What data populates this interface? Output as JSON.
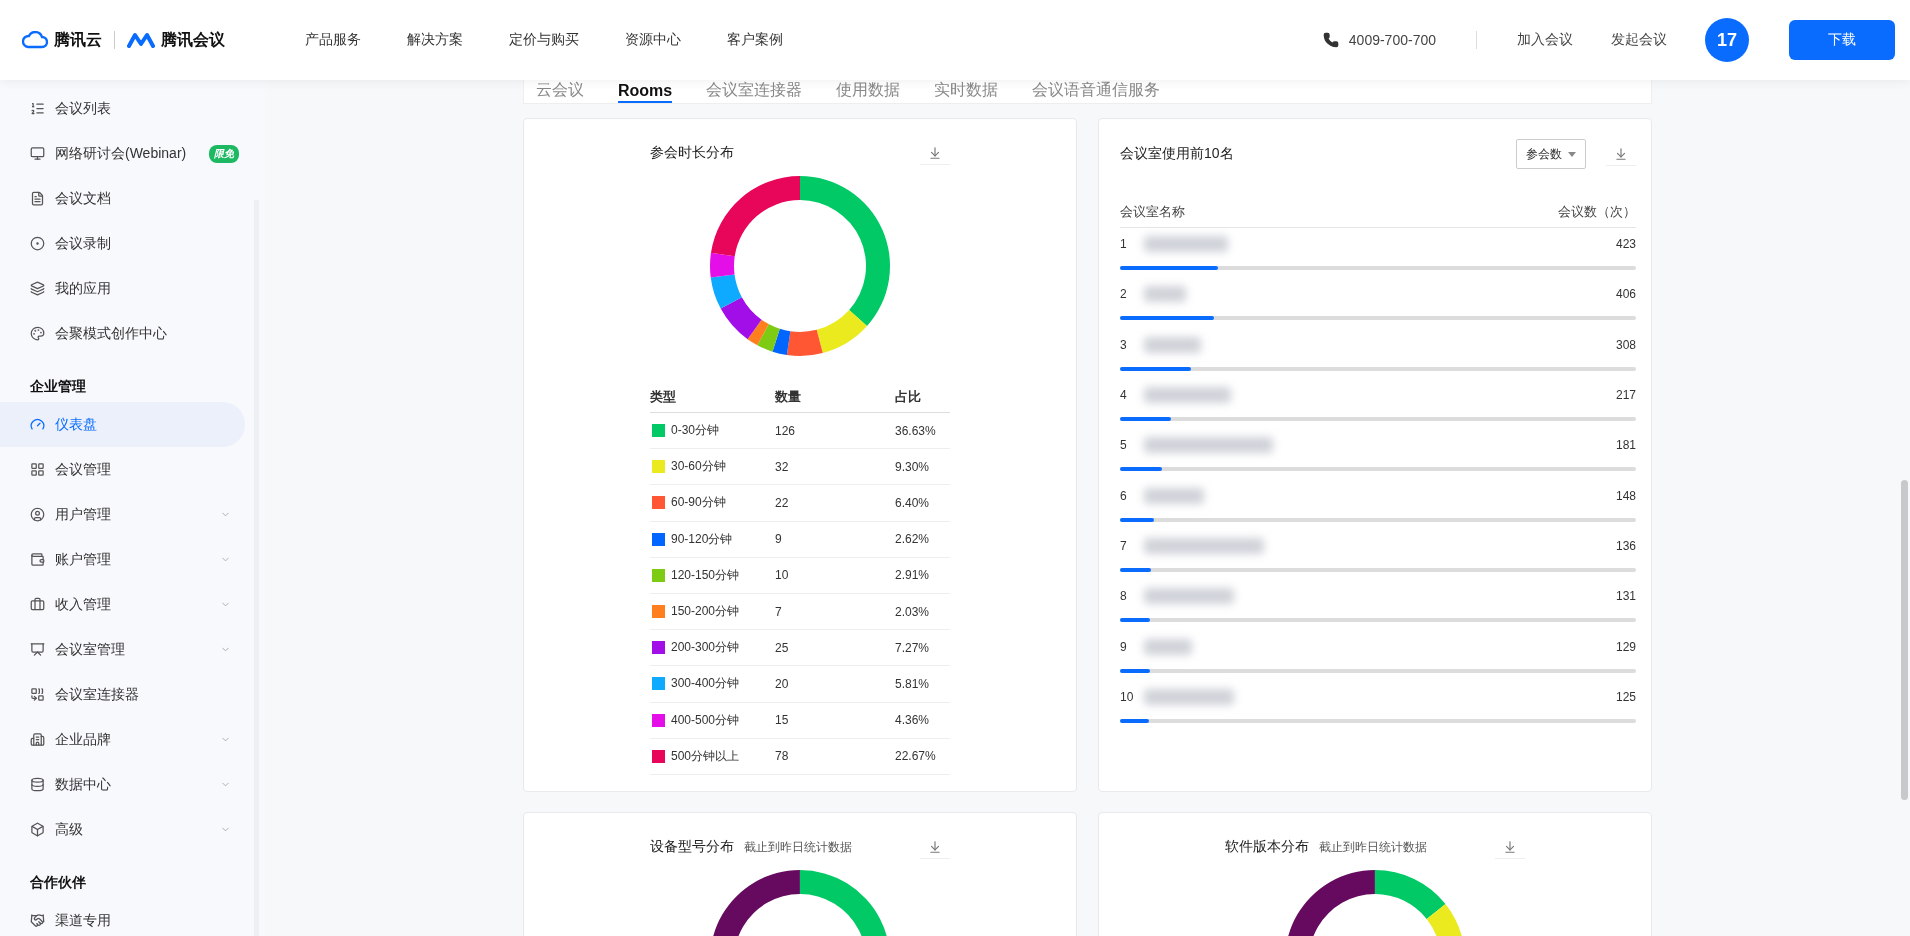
{
  "header": {
    "logo_cloud": "腾讯云",
    "logo_meeting": "腾讯会议",
    "nav": [
      "产品服务",
      "解决方案",
      "定价与购买",
      "资源中心",
      "客户案例"
    ],
    "phone": "4009-700-700",
    "links": [
      "加入会议",
      "发起会议"
    ],
    "avatar": "17",
    "download": "下载"
  },
  "sidebar": {
    "items": [
      {
        "kind": "item",
        "label": "会议列表",
        "selected": false,
        "collapsible": false
      },
      {
        "kind": "item",
        "label": "网络研讨会(Webinar)",
        "selected": false,
        "collapsible": false,
        "badge": "限免"
      },
      {
        "kind": "item",
        "label": "会议文档",
        "selected": false,
        "collapsible": false
      },
      {
        "kind": "item",
        "label": "会议录制",
        "selected": false,
        "collapsible": false
      },
      {
        "kind": "item",
        "label": "我的应用",
        "selected": false,
        "collapsible": false
      },
      {
        "kind": "item",
        "label": "会聚模式创作中心",
        "selected": false,
        "collapsible": false
      },
      {
        "kind": "section",
        "label": "企业管理"
      },
      {
        "kind": "item",
        "label": "仪表盘",
        "selected": true,
        "collapsible": false
      },
      {
        "kind": "item",
        "label": "会议管理",
        "selected": false,
        "collapsible": false
      },
      {
        "kind": "item",
        "label": "用户管理",
        "selected": false,
        "collapsible": true
      },
      {
        "kind": "item",
        "label": "账户管理",
        "selected": false,
        "collapsible": true
      },
      {
        "kind": "item",
        "label": "收入管理",
        "selected": false,
        "collapsible": true
      },
      {
        "kind": "item",
        "label": "会议室管理",
        "selected": false,
        "collapsible": true
      },
      {
        "kind": "item",
        "label": "会议室连接器",
        "selected": false,
        "collapsible": false
      },
      {
        "kind": "item",
        "label": "企业品牌",
        "selected": false,
        "collapsible": true
      },
      {
        "kind": "item",
        "label": "数据中心",
        "selected": false,
        "collapsible": true
      },
      {
        "kind": "item",
        "label": "高级",
        "selected": false,
        "collapsible": true
      },
      {
        "kind": "section",
        "label": "合作伙伴"
      },
      {
        "kind": "item",
        "label": "渠道专用",
        "selected": false,
        "collapsible": false
      }
    ]
  },
  "tabs": [
    {
      "label": "云会议",
      "selected": false
    },
    {
      "label": "Rooms",
      "selected": true
    },
    {
      "label": "会议室连接器",
      "selected": false
    },
    {
      "label": "使用数据",
      "selected": false
    },
    {
      "label": "实时数据",
      "selected": false
    },
    {
      "label": "会议语音通信服务",
      "selected": false
    }
  ],
  "duration_card": {
    "chart_data": {
      "type": "donut",
      "title": "参会时长分布",
      "categories": [
        "0-30分钟",
        "30-60分钟",
        "60-90分钟",
        "90-120分钟",
        "120-150分钟",
        "150-200分钟",
        "200-300分钟",
        "300-400分钟",
        "400-500分钟",
        "500分钟以上"
      ],
      "series": [
        {
          "name": "占比",
          "values": [
            36.63,
            9.3,
            6.4,
            2.62,
            2.91,
            2.03,
            7.27,
            5.81,
            4.36,
            22.67
          ]
        }
      ]
    },
    "columns": [
      "类型",
      "数量"
    ],
    "rows": [
      {
        "count": "126",
        "share": "36.63%",
        "color": "#00c965"
      },
      {
        "count": "32",
        "share": "9.30%",
        "color": "#eaea1e"
      },
      {
        "count": "22",
        "share": "6.40%",
        "color": "#ff5733"
      },
      {
        "count": "9",
        "share": "2.62%",
        "color": "#0066ff"
      },
      {
        "count": "10",
        "share": "2.91%",
        "color": "#7ecb14"
      },
      {
        "count": "7",
        "share": "2.03%",
        "color": "#ff7f1e"
      },
      {
        "count": "25",
        "share": "7.27%",
        "color": "#a10ee8"
      },
      {
        "count": "20",
        "share": "5.81%",
        "color": "#0eaaff"
      },
      {
        "count": "15",
        "share": "4.36%",
        "color": "#e40ee8"
      },
      {
        "count": "78",
        "share": "22.67%",
        "color": "#e8065a"
      }
    ]
  },
  "room_card": {
    "title": "会议室使用前10名",
    "sort_select": "参会数",
    "columns": [
      "会议室名称",
      "会议数（次）"
    ],
    "rows": [
      {
        "rank": "1",
        "count": "423",
        "level": 0.19
      },
      {
        "rank": "2",
        "count": "406",
        "level": 0.183
      },
      {
        "rank": "3",
        "count": "308",
        "level": 0.138
      },
      {
        "rank": "4",
        "count": "217",
        "level": 0.098
      },
      {
        "rank": "5",
        "count": "181",
        "level": 0.082
      },
      {
        "rank": "6",
        "count": "148",
        "level": 0.066
      },
      {
        "rank": "7",
        "count": "136",
        "level": 0.06
      },
      {
        "rank": "8",
        "count": "131",
        "level": 0.058
      },
      {
        "rank": "9",
        "count": "129",
        "level": 0.058
      },
      {
        "rank": "10",
        "count": "125",
        "level": 0.056
      }
    ]
  },
  "bottom_cards": [
    {
      "title": "设备型号分布",
      "note": "截止到昨日统计数据"
    },
    {
      "title": "软件版本分布",
      "note": "截止到昨日统计数据"
    }
  ]
}
